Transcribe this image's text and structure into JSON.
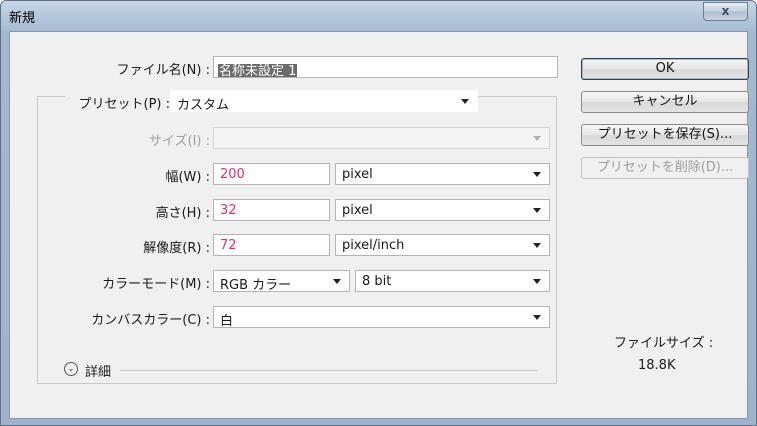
{
  "window": {
    "title": "新規",
    "close_glyph": "x"
  },
  "form": {
    "name_label": "ファイル名(N) :",
    "name_value": "名称未設定 1",
    "preset_label": "プリセット(P) :",
    "preset_value": "カスタム",
    "size_label": "サイズ(I) :",
    "size_value": "",
    "width_label": "幅(W) :",
    "width_value": "200",
    "width_unit": "pixel",
    "height_label": "高さ(H) :",
    "height_value": "32",
    "height_unit": "pixel",
    "resolution_label": "解像度(R) :",
    "resolution_value": "72",
    "resolution_unit": "pixel/inch",
    "color_mode_label": "カラーモード(M) :",
    "color_mode_value": "RGB カラー",
    "bit_depth_value": "8 bit",
    "background_label": "カンバスカラー(C) :",
    "background_value": "白",
    "advanced_label": "詳細"
  },
  "buttons": {
    "ok": "OK",
    "cancel": "キャンセル",
    "save_preset": "プリセットを保存(S)...",
    "delete_preset": "プリセットを削除(D)..."
  },
  "file_size": {
    "label": "ファイルサイズ :",
    "value": "18.8K"
  },
  "icons": {
    "close": "close-icon",
    "dropdown": "chevron-down-icon",
    "toggle": "chevron-double-down-icon"
  }
}
